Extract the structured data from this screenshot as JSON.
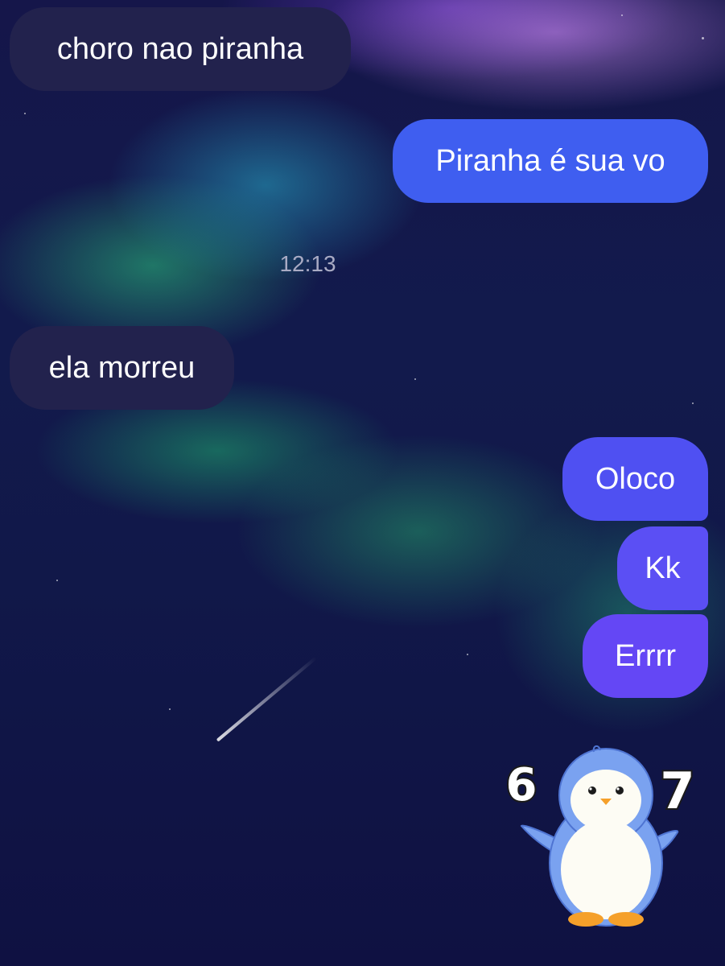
{
  "messages": [
    {
      "id": 1,
      "direction": "incoming",
      "text": "choro nao piranha"
    },
    {
      "id": 2,
      "direction": "outgoing",
      "text": "Piranha é sua vo"
    },
    {
      "id": 3,
      "direction": "incoming",
      "text": "ela morreu"
    },
    {
      "id": 4,
      "direction": "outgoing",
      "text": "Oloco"
    },
    {
      "id": 5,
      "direction": "outgoing",
      "text": "Kk"
    },
    {
      "id": 6,
      "direction": "outgoing",
      "text": "Errrr"
    }
  ],
  "timestamp": "12:13",
  "sticker": {
    "icon": "penguin-67-sticker",
    "left_text": "6",
    "right_text": "7"
  },
  "colors": {
    "incoming_bubble": "#22224d",
    "outgoing_bubble_1": "#3f5ef0",
    "outgoing_bubble_2": "#4f50f2",
    "outgoing_bubble_3": "#5b4ff4",
    "outgoing_bubble_4": "#6447f5",
    "timestamp_text": "#a9abc4"
  }
}
